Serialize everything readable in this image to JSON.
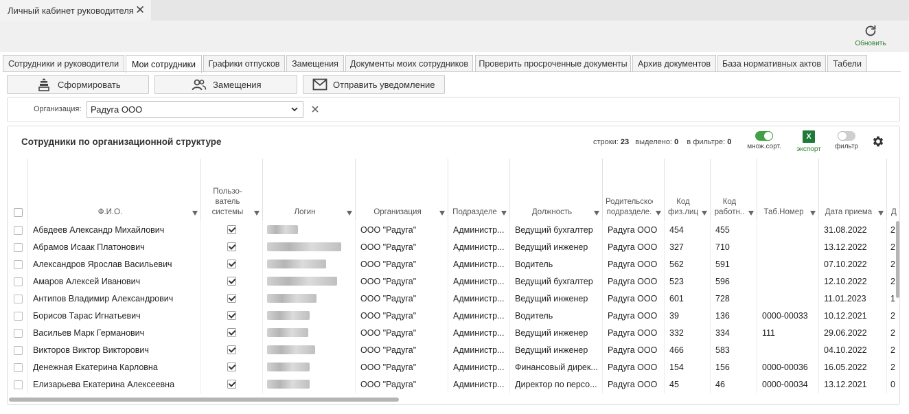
{
  "window": {
    "tab_title": "Личный кабинет руководителя"
  },
  "toolbar": {
    "refresh_label": "Обновить"
  },
  "tabs": [
    {
      "label": "Сотрудники и руководители",
      "active": false
    },
    {
      "label": "Мои сотрудники",
      "active": true
    },
    {
      "label": "Графики отпусков",
      "active": false
    },
    {
      "label": "Замещения",
      "active": false
    },
    {
      "label": "Документы моих сотрудников",
      "active": false
    },
    {
      "label": "Проверить просроченные документы",
      "active": false
    },
    {
      "label": "Архив документов",
      "active": false
    },
    {
      "label": "База нормативных актов",
      "active": false
    },
    {
      "label": "Табели",
      "active": false
    }
  ],
  "actions": {
    "form_label": "Сформировать",
    "substitutions_label": "Замещения",
    "notify_label": "Отправить уведомление"
  },
  "filter": {
    "org_label": "Организация:",
    "org_value": "Радуга ООО"
  },
  "grid": {
    "title": "Сотрудники по организационной структуре",
    "stats": {
      "rows_label": "строки:",
      "rows_value": "23",
      "selected_label": "выделено:",
      "selected_value": "0",
      "filter_label": "в фильтре:",
      "filter_value": "0"
    },
    "controls": {
      "multisort_label": "множ.сорт.",
      "multisort_on": true,
      "export_label": "экспорт",
      "export_icon": "X",
      "filter_label": "фильтр",
      "filter_on": false
    },
    "columns": [
      {
        "label": "Ф.И.О."
      },
      {
        "label": "Пользо-\nватель\nсистемы"
      },
      {
        "label": "Логин"
      },
      {
        "label": "Организация"
      },
      {
        "label": "Подразделе"
      },
      {
        "label": "Должность"
      },
      {
        "label": "Родительское\nподразделе."
      },
      {
        "label": "Код\nфиз.лиц"
      },
      {
        "label": "Код\nработн.."
      },
      {
        "label": "Таб.Номер"
      },
      {
        "label": "Дата приема"
      },
      {
        "label": "Д"
      }
    ],
    "rows": [
      {
        "fio": "Абвдеев Александр Михайлович",
        "org": "ООО \"Радуга\"",
        "dept": "Администр...",
        "position": "Ведущий бухгалтер",
        "parent": "Радуга ООО",
        "code_person": "454",
        "code_emp": "455",
        "tab_no": "",
        "hire_date": "31.08.2022",
        "d": "2"
      },
      {
        "fio": "Абрамов Исаак Платонович",
        "org": "ООО \"Радуга\"",
        "dept": "Администр...",
        "position": "Ведущий инженер",
        "parent": "Радуга ООО",
        "code_person": "327",
        "code_emp": "710",
        "tab_no": "",
        "hire_date": "13.12.2022",
        "d": "2"
      },
      {
        "fio": "Александров Ярослав Васильевич",
        "org": "ООО \"Радуга\"",
        "dept": "Администр...",
        "position": "Водитель",
        "parent": "Радуга ООО",
        "code_person": "562",
        "code_emp": "591",
        "tab_no": "",
        "hire_date": "07.10.2022",
        "d": "2"
      },
      {
        "fio": "Амаров Алексей Иванович",
        "org": "ООО \"Радуга\"",
        "dept": "Администр...",
        "position": "Ведущий бухгалтер",
        "parent": "Радуга ООО",
        "code_person": "523",
        "code_emp": "596",
        "tab_no": "",
        "hire_date": "12.10.2022",
        "d": "2"
      },
      {
        "fio": "Антипов Владимир Александрович",
        "org": "ООО \"Радуга\"",
        "dept": "Администр...",
        "position": "Ведущий инженер",
        "parent": "Радуга ООО",
        "code_person": "601",
        "code_emp": "728",
        "tab_no": "",
        "hire_date": "11.01.2023",
        "d": "1"
      },
      {
        "fio": "Борисов Тарас Игнатьевич",
        "org": "ООО \"Радуга\"",
        "dept": "Администр...",
        "position": "Водитель",
        "parent": "Радуга ООО",
        "code_person": "39",
        "code_emp": "136",
        "tab_no": "0000-00033",
        "hire_date": "10.12.2021",
        "d": "2"
      },
      {
        "fio": "Васильев Марк Германович",
        "org": "ООО \"Радуга\"",
        "dept": "Администр...",
        "position": "Ведущий инженер",
        "parent": "Радуга ООО",
        "code_person": "332",
        "code_emp": "334",
        "tab_no": "111",
        "hire_date": "29.06.2022",
        "d": "2"
      },
      {
        "fio": "Викторов Виктор Викторович",
        "org": "ООО \"Радуга\"",
        "dept": "Администр...",
        "position": "Ведущий инженер",
        "parent": "Радуга ООО",
        "code_person": "466",
        "code_emp": "583",
        "tab_no": "",
        "hire_date": "04.10.2022",
        "d": "2"
      },
      {
        "fio": "Денежная Екатерина Карловна",
        "org": "ООО \"Радуга\"",
        "dept": "Администр...",
        "position": "Финансовый дирек...",
        "parent": "Радуга ООО",
        "code_person": "154",
        "code_emp": "156",
        "tab_no": "0000-00036",
        "hire_date": "16.05.2022",
        "d": "2"
      },
      {
        "fio": "Елизарьева Екатерина Алексеевна",
        "org": "ООО \"Радуга\"",
        "dept": "Администр...",
        "position": "Директор по персо...",
        "parent": "Радуга ООО",
        "code_person": "45",
        "code_emp": "46",
        "tab_no": "0000-00034",
        "hire_date": "13.12.2021",
        "d": "0"
      }
    ]
  }
}
